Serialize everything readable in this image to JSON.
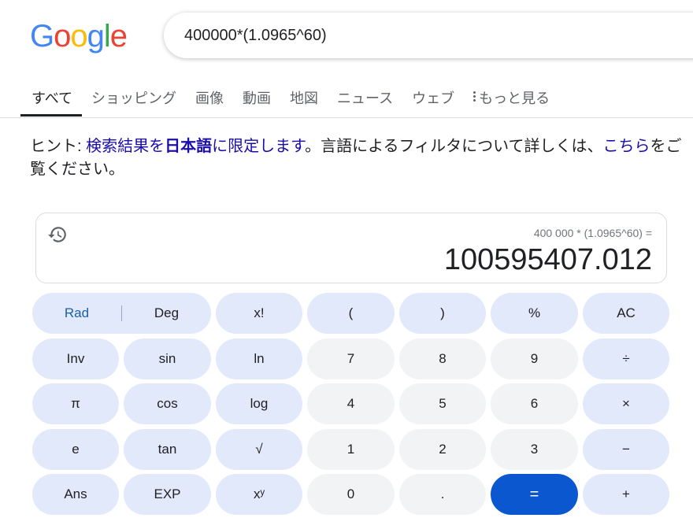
{
  "logo": {
    "letters": [
      "G",
      "o",
      "o",
      "g",
      "l",
      "e"
    ],
    "colors": [
      "#4285F4",
      "#EA4335",
      "#FBBC05",
      "#4285F4",
      "#34A853",
      "#EA4335"
    ]
  },
  "search": {
    "value": "400000*(1.0965^60)"
  },
  "tabs": [
    {
      "label": "すべて",
      "active": true
    },
    {
      "label": "ショッピング"
    },
    {
      "label": "画像"
    },
    {
      "label": "動画"
    },
    {
      "label": "地図"
    },
    {
      "label": "ニュース"
    },
    {
      "label": "ウェブ"
    }
  ],
  "tabs_more": "もっと見る",
  "hint": {
    "prefix": "ヒント: ",
    "link1": "検索結果を",
    "bold": "日本語",
    "link2": "に限定します",
    "middle": "。言語によるフィルタについて詳しくは、",
    "link3": "こちら",
    "suffix": "をご覧ください。"
  },
  "calculator": {
    "expression": "400 000 * (1.0965^60) =",
    "result": "100595407.012",
    "rad": "Rad",
    "deg": "Deg",
    "keys": {
      "fact": "x!",
      "lparen": "(",
      "rparen": ")",
      "percent": "%",
      "ac": "AC",
      "inv": "Inv",
      "sin": "sin",
      "ln": "ln",
      "n7": "7",
      "n8": "8",
      "n9": "9",
      "div": "÷",
      "pi": "π",
      "cos": "cos",
      "log": "log",
      "n4": "4",
      "n5": "5",
      "n6": "6",
      "mul": "×",
      "e": "e",
      "tan": "tan",
      "sqrt": "√",
      "n1": "1",
      "n2": "2",
      "n3": "3",
      "minus": "−",
      "ans": "Ans",
      "exp": "EXP",
      "pow": "xʸ",
      "n0": "0",
      "dot": ".",
      "eq": "=",
      "plus": "+"
    },
    "colors": {
      "fn_key": "#e2e9fb",
      "num_key": "#f1f3f4",
      "equals": "#0b57d0"
    }
  }
}
